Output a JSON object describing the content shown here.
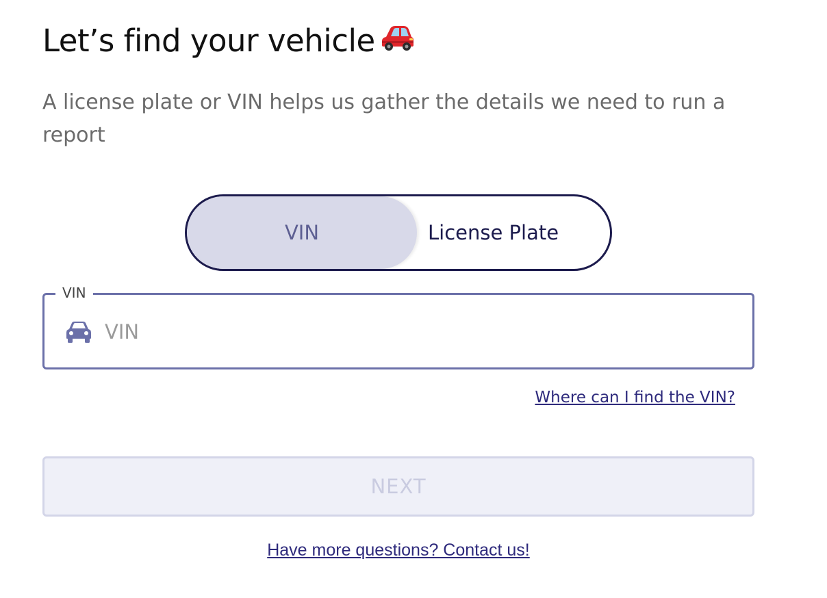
{
  "header": {
    "title": "Let’s find your vehicle",
    "title_emoji": "red-car-icon",
    "subtitle": "A license plate or VIN helps us gather the details we need to run a report"
  },
  "toggle": {
    "options": [
      {
        "label": "VIN",
        "selected": true
      },
      {
        "label": "License Plate",
        "selected": false
      }
    ]
  },
  "vin_field": {
    "legend": "VIN",
    "icon": "car-icon",
    "placeholder": "VIN",
    "value": ""
  },
  "links": {
    "vin_help": "Where can I find the VIN?",
    "contact": "Have more questions? Contact us!"
  },
  "actions": {
    "next_label": "NEXT",
    "next_enabled": false
  },
  "colors": {
    "accent": "#2e2a7c",
    "toggle_border": "#1c1b4d",
    "toggle_selected_bg": "#d8d9e9",
    "field_border": "#6b70a9",
    "button_disabled_bg": "#eff0f8",
    "button_disabled_text": "#c9cbe0"
  }
}
